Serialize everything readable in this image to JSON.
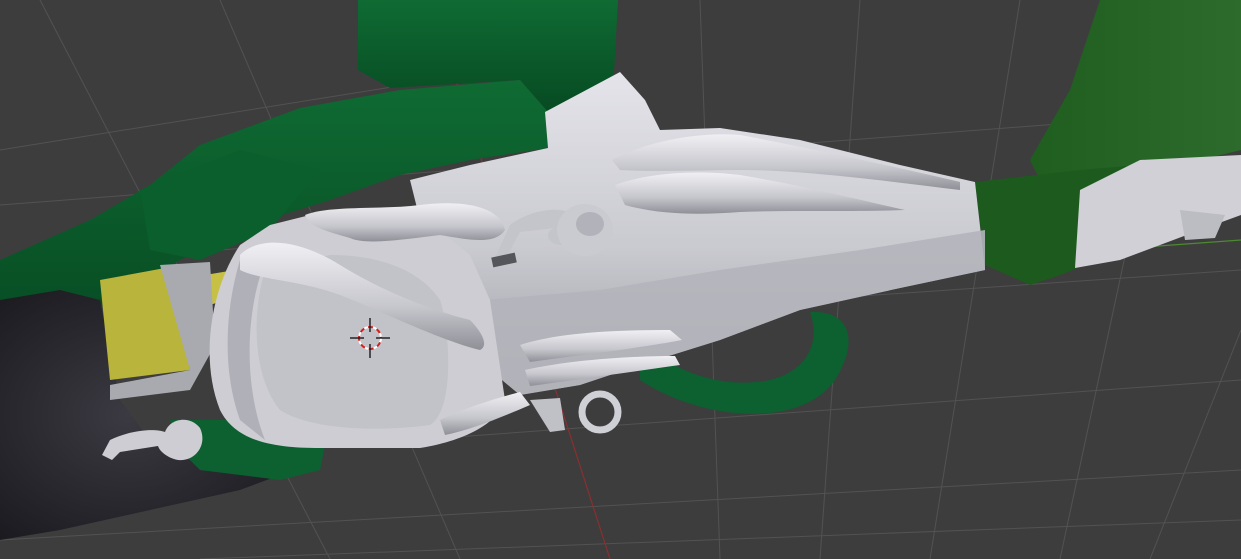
{
  "app": {
    "view": "3d-viewport",
    "shading": "solid"
  },
  "colors": {
    "background": "#3d3d3d",
    "grid_line": "#555555",
    "axis_x": "#8a2f2f",
    "axis_y": "#4c8a2f",
    "body_light": "#d7d7dd",
    "body_mid": "#b9b9c0",
    "body_dark": "#8e8e96",
    "green_dark": "#0a5a2a",
    "green_mid": "#0f6b33",
    "green_right": "#1e5a1e",
    "yellow_panel": "#b9b43c",
    "dark_mesh": "#232228",
    "cursor_red": "#d81e1e"
  },
  "icons": {
    "cursor": "3d-cursor-icon"
  }
}
